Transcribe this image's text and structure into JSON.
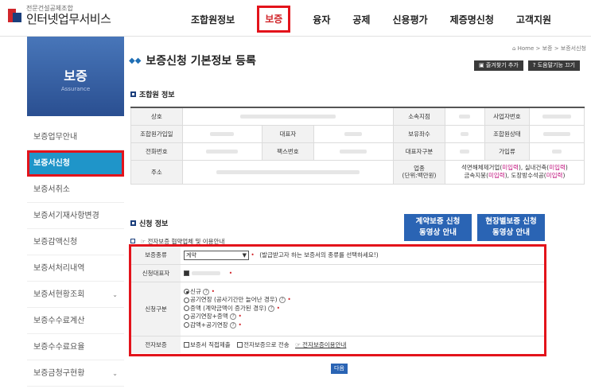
{
  "header": {
    "logo_small": "전문건설공제조합",
    "logo_big": "인터넷업무서비스",
    "nav": [
      "조합원정보",
      "보증",
      "융자",
      "공제",
      "신용평가",
      "제증명신청",
      "고객지원"
    ],
    "active_nav": "보증"
  },
  "sidebar": {
    "banner_title": "보증",
    "banner_sub": "Assurance",
    "items": [
      {
        "label": "보증업무안내",
        "chevron": ""
      },
      {
        "label": "보증서신청",
        "chevron": ""
      },
      {
        "label": "보증서취소",
        "chevron": ""
      },
      {
        "label": "보증서기재사항변경",
        "chevron": ""
      },
      {
        "label": "보증감액신청",
        "chevron": ""
      },
      {
        "label": "보증서처리내역",
        "chevron": ""
      },
      {
        "label": "보증서현황조회",
        "chevron": "⌄"
      },
      {
        "label": "보증수수료계산",
        "chevron": ""
      },
      {
        "label": "보증수수료요율",
        "chevron": ""
      },
      {
        "label": "보증금청구현황",
        "chevron": "⌄"
      }
    ]
  },
  "main": {
    "breadcrumb": "⌂ Home > 보증 > 보증서신청",
    "title": "보증신청 기본정보 등록",
    "bookmark_btn": "즐겨찾기 추가",
    "help_btn": "도움말기능 끄기",
    "member_section": "조합원 정보",
    "info_labels": {
      "sangho": "상호",
      "sosok": "소속지점",
      "bizno": "사업자번호",
      "joindate": "조합원가입일",
      "ceo": "대표자",
      "shares": "보유좌수",
      "status": "조합원상태",
      "phone": "전화번호",
      "fax": "팩스번호",
      "ceotype": "대표자구분",
      "grade": "가입류",
      "address": "주소",
      "biztype": "업종\n(단위:백만원)"
    },
    "biztype_line1_a": "석면해체제거업(",
    "biztype_line1_b": "미입력",
    "biztype_line1_c": "), 실내건축(",
    "biztype_line1_d": "미입력",
    "biztype_line1_e": ")",
    "biztype_line2_a": "금속지붕(",
    "biztype_line2_b": "미입력",
    "biztype_line2_c": "), 도장방수석공(",
    "biztype_line2_d": "미입력",
    "biztype_line2_e": ")",
    "apply_section": "신청 정보",
    "btn_contract": "계약보증 신청\n동영상 안내",
    "btn_site": "현장별보증 신청\n동영상 안내",
    "link_text": "☞ 전자보증 협약업체 및 이용안내",
    "form": {
      "type_label": "보증종류",
      "type_value": "계약",
      "type_hint": "(발급받고자 하는 보증서의 종류를 선택하세요!)",
      "rep_label": "신청대표자",
      "kind_label": "신청구분",
      "kind_options": [
        "신규",
        "공기연장 (공사기간만 늘어난 경우)",
        "증액 (계약금액이 증가된 경우)",
        "공기연장+증액",
        "감액+공기연장"
      ],
      "ebond_label": "전자보증",
      "ebond_opt1": "보증서 직접제출",
      "ebond_opt2": "전자보증으로 전송",
      "ebond_link": "☞ 전자보증이용안내"
    },
    "next_btn": "다음"
  }
}
